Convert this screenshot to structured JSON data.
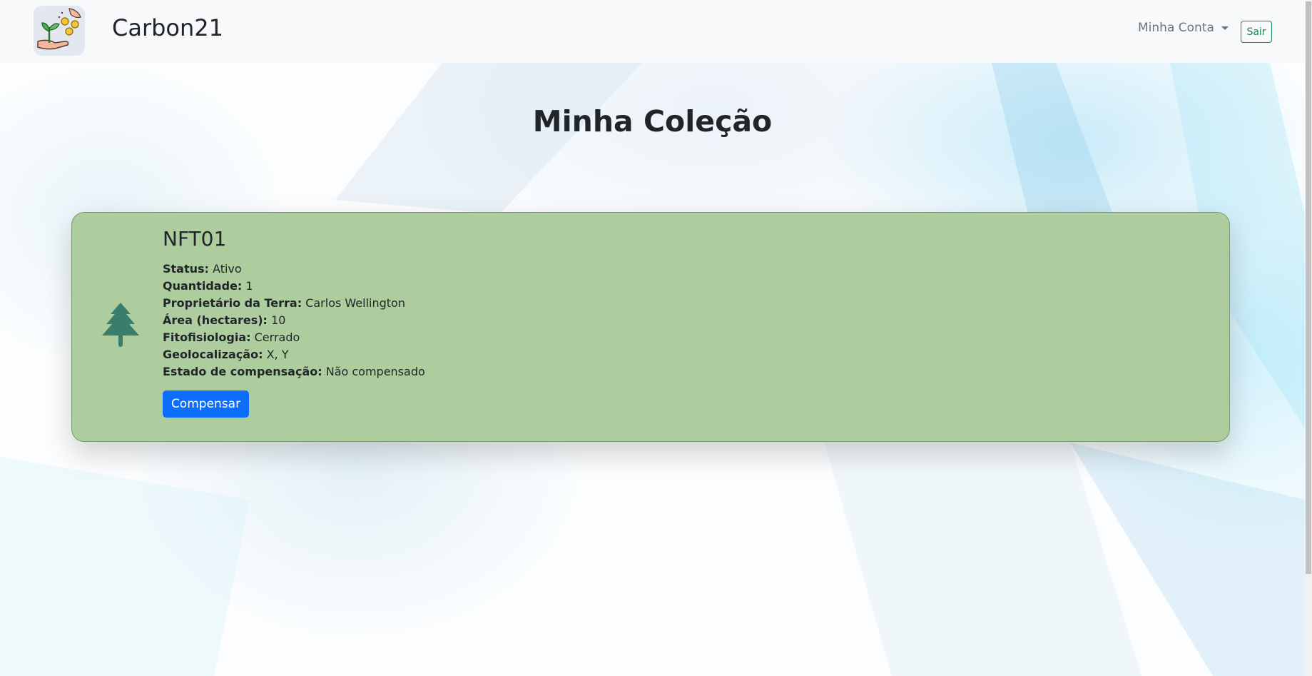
{
  "navbar": {
    "brand": "Carbon21",
    "account_label": "Minha Conta",
    "logout_label": "Sair"
  },
  "main": {
    "title": "Minha Coleção"
  },
  "nft": {
    "name": "NFT01",
    "fields": [
      {
        "label": "Status:",
        "value": "Ativo"
      },
      {
        "label": "Quantidade:",
        "value": "1"
      },
      {
        "label": "Proprietário da Terra:",
        "value": "Carlos Wellington"
      },
      {
        "label": "Área (hectares):",
        "value": "10"
      },
      {
        "label": "Fitofisiologia:",
        "value": "Cerrado"
      },
      {
        "label": "Geolocalização:",
        "value": "X, Y"
      },
      {
        "label": "Estado de compensação:",
        "value": "Não compensado"
      }
    ],
    "action_label": "Compensar",
    "icon": "tree-icon"
  },
  "colors": {
    "card_bg": "#adcd9e",
    "primary": "#0d6efd",
    "success": "#198754",
    "tree": "#3a7d6b"
  }
}
